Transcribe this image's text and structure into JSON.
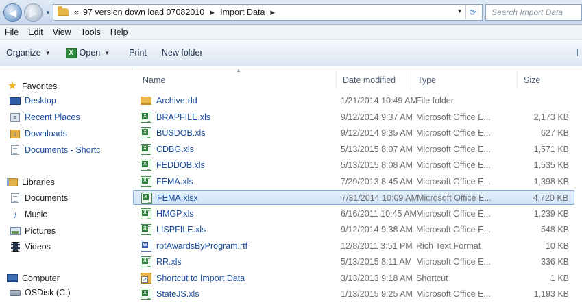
{
  "address": {
    "breadcrumb_prefix": "«",
    "crumbs": [
      "97 version down load 07082010",
      "Import Data"
    ],
    "search_placeholder": "Search Import Data"
  },
  "menu": [
    "File",
    "Edit",
    "View",
    "Tools",
    "Help"
  ],
  "toolbar": {
    "organize": "Organize",
    "open": "Open",
    "print": "Print",
    "new_folder": "New folder"
  },
  "nav": {
    "favorites": "Favorites",
    "favorite_items": [
      "Desktop",
      "Recent Places",
      "Downloads",
      "Documents - Shortc"
    ],
    "libraries": "Libraries",
    "library_items": [
      "Documents",
      "Music",
      "Pictures",
      "Videos"
    ],
    "computer": "Computer",
    "computer_items": [
      "OSDisk (C:)"
    ]
  },
  "columns": {
    "name": "Name",
    "date": "Date modified",
    "type": "Type",
    "size": "Size"
  },
  "files": [
    {
      "icon": "folder-icon",
      "name": "Archive-dd",
      "date": "1/21/2014 10:49 AM",
      "type": "File folder",
      "size": ""
    },
    {
      "icon": "excel-file-icon",
      "name": "BRAPFILE.xls",
      "date": "9/12/2014 9:37 AM",
      "type": "Microsoft Office E...",
      "size": "2,173 KB"
    },
    {
      "icon": "excel-file-icon",
      "name": "BUSDOB.xls",
      "date": "9/12/2014 9:35 AM",
      "type": "Microsoft Office E...",
      "size": "627 KB"
    },
    {
      "icon": "excel-file-icon",
      "name": "CDBG.xls",
      "date": "5/13/2015 8:07 AM",
      "type": "Microsoft Office E...",
      "size": "1,571 KB"
    },
    {
      "icon": "excel-file-icon",
      "name": "FEDDOB.xls",
      "date": "5/13/2015 8:08 AM",
      "type": "Microsoft Office E...",
      "size": "1,535 KB"
    },
    {
      "icon": "excel-file-icon",
      "name": "FEMA.xls",
      "date": "7/29/2013 8:45 AM",
      "type": "Microsoft Office E...",
      "size": "1,398 KB"
    },
    {
      "icon": "excel-file-icon",
      "name": "FEMA.xlsx",
      "date": "7/31/2014 10:09 AM",
      "type": "Microsoft Office E...",
      "size": "4,720 KB",
      "selected": true
    },
    {
      "icon": "excel-file-icon",
      "name": "HMGP.xls",
      "date": "6/16/2011 10:45 AM",
      "type": "Microsoft Office E...",
      "size": "1,239 KB"
    },
    {
      "icon": "excel-file-icon",
      "name": "LISPFILE.xls",
      "date": "9/12/2014 9:38 AM",
      "type": "Microsoft Office E...",
      "size": "548 KB"
    },
    {
      "icon": "word-file-icon",
      "name": "rptAwardsByProgram.rtf",
      "date": "12/8/2011 3:51 PM",
      "type": "Rich Text Format",
      "size": "10 KB"
    },
    {
      "icon": "excel-file-icon",
      "name": "RR.xls",
      "date": "5/13/2015 8:11 AM",
      "type": "Microsoft Office E...",
      "size": "336 KB"
    },
    {
      "icon": "shortcut-icon",
      "name": "Shortcut to Import Data",
      "date": "3/13/2013 9:18 AM",
      "type": "Shortcut",
      "size": "1 KB"
    },
    {
      "icon": "excel-file-icon",
      "name": "StateJS.xls",
      "date": "1/13/2015 9:25 AM",
      "type": "Microsoft Office E...",
      "size": "1,193 KB"
    }
  ]
}
